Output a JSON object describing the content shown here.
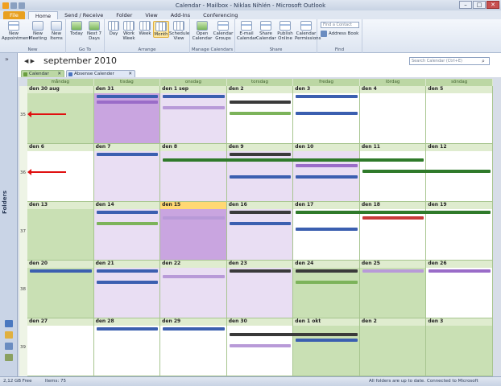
{
  "window": {
    "title": "Calendar - Mailbox - Niklas Nihlén - Microsoft Outlook"
  },
  "ribbon_tabs": [
    "File",
    "Home",
    "Send / Receive",
    "Folder",
    "View",
    "Add-Ins",
    "Conferencing"
  ],
  "ribbon_groups": [
    {
      "label": "New",
      "buttons": [
        "New Appointment",
        "New Meeting",
        "New Items"
      ]
    },
    {
      "label": "Go To",
      "buttons": [
        "Today",
        "Next 7 Days"
      ]
    },
    {
      "label": "Arrange",
      "buttons": [
        "Day",
        "Work Week",
        "Week",
        "Month",
        "Schedule View"
      ]
    },
    {
      "label": "Manage Calendars",
      "buttons": [
        "Open Calendar",
        "Calendar Groups"
      ]
    },
    {
      "label": "Share",
      "buttons": [
        "E-mail Calendar",
        "Share Calendar",
        "Publish Online",
        "Calendar Permissions"
      ]
    },
    {
      "label": "Find",
      "buttons": [
        "Address Book"
      ]
    }
  ],
  "find": {
    "contact_placeholder": "Find a Contact",
    "address_book_label": "Address Book"
  },
  "sidebar": {
    "label": "Folders"
  },
  "view": {
    "nav_left": "◀",
    "nav_right": "▶",
    "month_title": "september 2010",
    "search_placeholder": "Search Calendar (Ctrl+E)"
  },
  "calendar_tabs": [
    {
      "label": "Calendar",
      "color": "#6a9e3f"
    },
    {
      "label": "Absense Calender",
      "color": "#4a74c0"
    }
  ],
  "day_names": [
    "måndag",
    "tisdag",
    "onsdag",
    "torsdag",
    "fredag",
    "lördag",
    "söndag"
  ],
  "weeks": [
    {
      "week": "35",
      "days": [
        "den 30 aug",
        "den 31",
        "den 1 sep",
        "den 2",
        "den 3",
        "den 4",
        "den 5"
      ]
    },
    {
      "week": "36",
      "days": [
        "den 6",
        "den 7",
        "den 8",
        "den 9",
        "den 10",
        "den 11",
        "den 12"
      ]
    },
    {
      "week": "37",
      "days": [
        "den 13",
        "den 14",
        "den 15",
        "den 16",
        "den 17",
        "den 18",
        "den 19"
      ]
    },
    {
      "week": "38",
      "days": [
        "den 20",
        "den 21",
        "den 22",
        "den 23",
        "den 24",
        "den 25",
        "den 26"
      ]
    },
    {
      "week": "39",
      "days": [
        "den 27",
        "den 28",
        "den 29",
        "den 30",
        "den 1 okt",
        "den 2",
        "den 3"
      ]
    }
  ],
  "status": {
    "free": "2,12 GB Free",
    "items": "Items: 75",
    "sync": "All folders are up to date.",
    "connection": "Connected to Microsoft Exchange"
  },
  "colors": {
    "green": "#bcd7a4",
    "today": "#ffd873",
    "purple": "#c9a5e0",
    "lavender": "#e3d6ef",
    "blue": "#3b5fb0",
    "darkgray": "#3a3a3a",
    "red": "#c83a3a",
    "darkgreen": "#2f7a2a"
  }
}
